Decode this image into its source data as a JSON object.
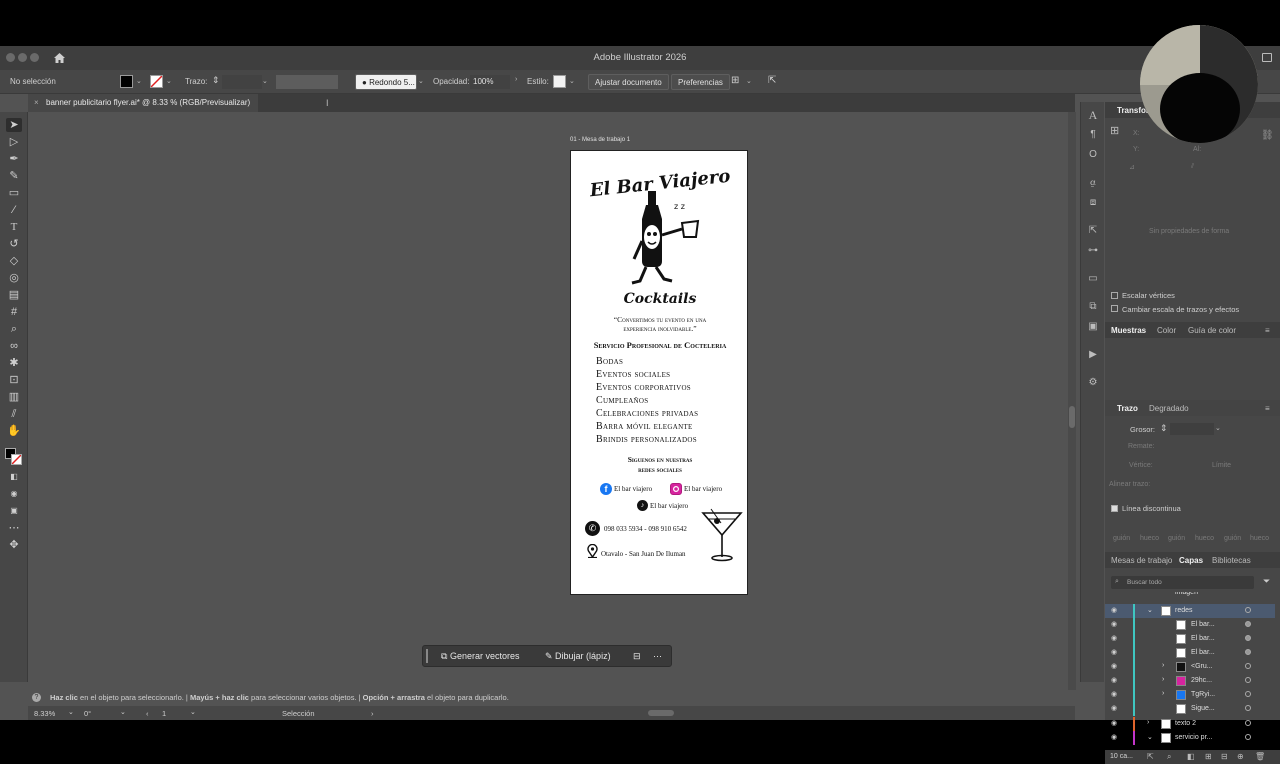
{
  "app": {
    "title": "Adobe Illustrator 2026"
  },
  "control_bar": {
    "selection": "No selección",
    "stroke_label": "Trazo:",
    "brush": "Redondo 5...",
    "opacity_label": "Opacidad:",
    "opacity_value": "100%",
    "style_label": "Estilo:",
    "adjust_doc": "Ajustar documento",
    "prefs": "Preferencias"
  },
  "tab": {
    "close": "×",
    "label": "banner publicitario flyer.ai* @ 8.33 % (RGB/Previsualizar)"
  },
  "artboard": {
    "label": "01 - Mesa de trabajo 1",
    "brand": "El Bar Viajero",
    "brand_sub": "Cocktails",
    "quote_line1": "“Convertimos tu evento en una",
    "quote_line2": "experiencia inolvidable.”",
    "heading": "Servicio Profesional de Cocteleria",
    "services": [
      "Bodas",
      "Eventos sociales",
      "Eventos corporativos",
      "Cumpleaños",
      "Celebraciones privadas",
      "Barra móvil elegante",
      "Brindis personalizados"
    ],
    "follow_line1": "Siguenos en nuestras",
    "follow_line2": "redes sociales",
    "facebook": "El bar viajero",
    "instagram": "El bar viajero",
    "tiktok": "El bar viajero",
    "phones": "098 033 5934 - 098 910 6542",
    "location": "Otavalo - San Juan De Iluman"
  },
  "floating_bar": {
    "generate": "Generar vectores",
    "draw": "Dibujar (lápiz)"
  },
  "hint": {
    "b1": "Haz clic",
    "t1": " en el objeto para seleccionarlo.  |  ",
    "b2": "Mayús + haz clic",
    "t2": " para seleccionar varios objetos.  |  ",
    "b3": "Opción + arrastra",
    "t3": " el objeto para duplicarlo."
  },
  "status": {
    "zoom": "8.33%",
    "rotation": "0°",
    "artboard_num": "1",
    "tool": "Selección"
  },
  "panel": {
    "transform_title": "Transfor",
    "x_label": "X:",
    "y_label": "Y:",
    "h_label": "Al:",
    "no_shape": "Sin propiedades de forma",
    "scale_corners": "Escalar vértices",
    "scale_strokes": "Cambiar escala de trazos y efectos",
    "swatches_tabs": [
      "Muestras",
      "Color",
      "Guía de color"
    ],
    "stroke_tabs": [
      "Trazo",
      "Degradado"
    ],
    "weight_label": "Grosor:",
    "cap_label": "Remate:",
    "corner_label": "Vértice:",
    "limit_label": "Límite",
    "align_label": "Alinear trazo:",
    "dashed": "Línea discontinua",
    "dash_labels": [
      "guión",
      "hueco",
      "guión",
      "hueco",
      "guión",
      "hueco"
    ],
    "layers_tabs": [
      "Mesas de trabajo",
      "Capas",
      "Bibliotecas"
    ],
    "search_placeholder": "Buscar todo",
    "layers": [
      {
        "name": "imagen"
      },
      {
        "name": "redes"
      },
      {
        "name": "El bar..."
      },
      {
        "name": "El bar..."
      },
      {
        "name": "El bar..."
      },
      {
        "name": "<Gru..."
      },
      {
        "name": "29hc..."
      },
      {
        "name": "TgRyi..."
      },
      {
        "name": "Sigue..."
      },
      {
        "name": "texto 2"
      },
      {
        "name": "servicio pr..."
      }
    ],
    "layers_count": "10 ca..."
  },
  "colors": {
    "accent_layer": "#3fc6c1",
    "selected_row": "#4b5a70",
    "panel_bg": "#474747",
    "canvas_bg": "#535353"
  }
}
